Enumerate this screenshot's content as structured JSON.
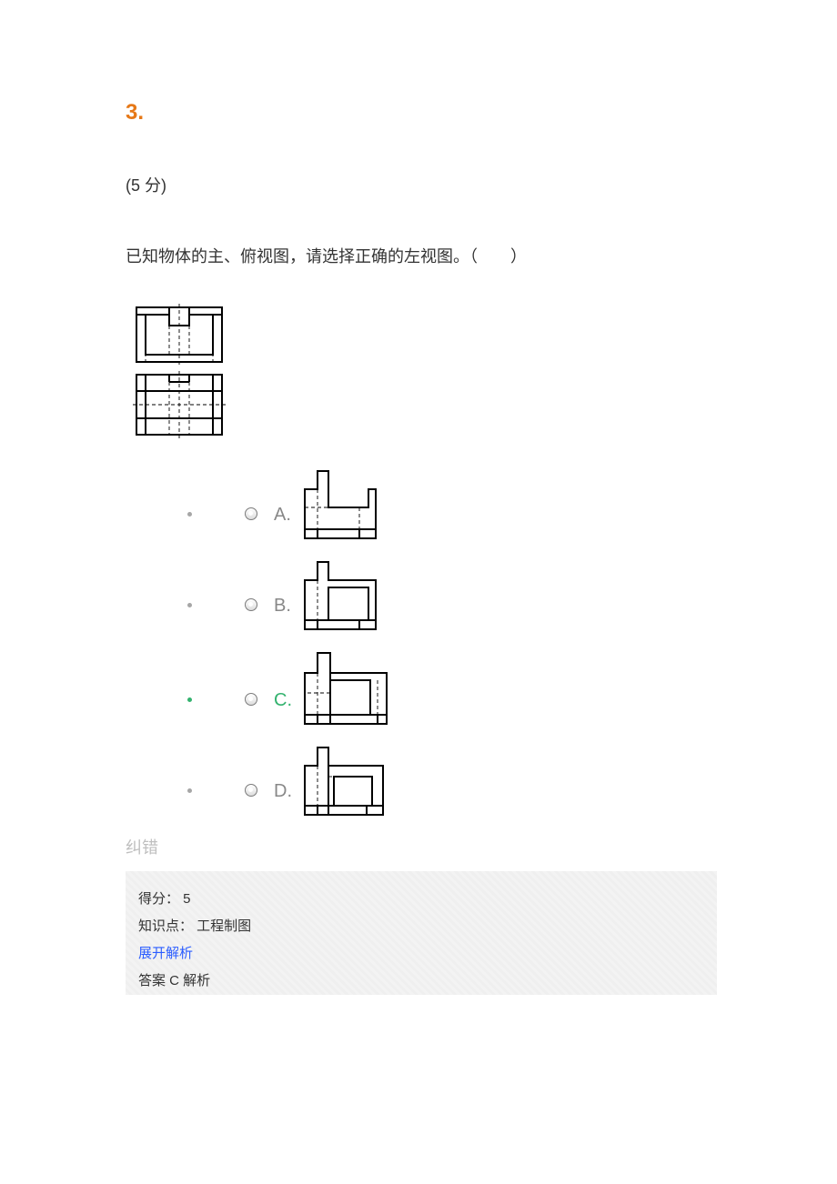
{
  "question": {
    "number": "3.",
    "points_text": "(5 分)",
    "stem": "已知物体的主、俯视图，请选择正确的左视图。（　　）"
  },
  "options": {
    "a_label": "A.",
    "b_label": "B.",
    "c_label": "C.",
    "d_label": "D."
  },
  "correction_link": "纠错",
  "panel": {
    "score_line": "得分： 5",
    "knowledge_line": "知识点： 工程制图",
    "expand": "展开解析",
    "answer_line": "答案 C  解析"
  }
}
